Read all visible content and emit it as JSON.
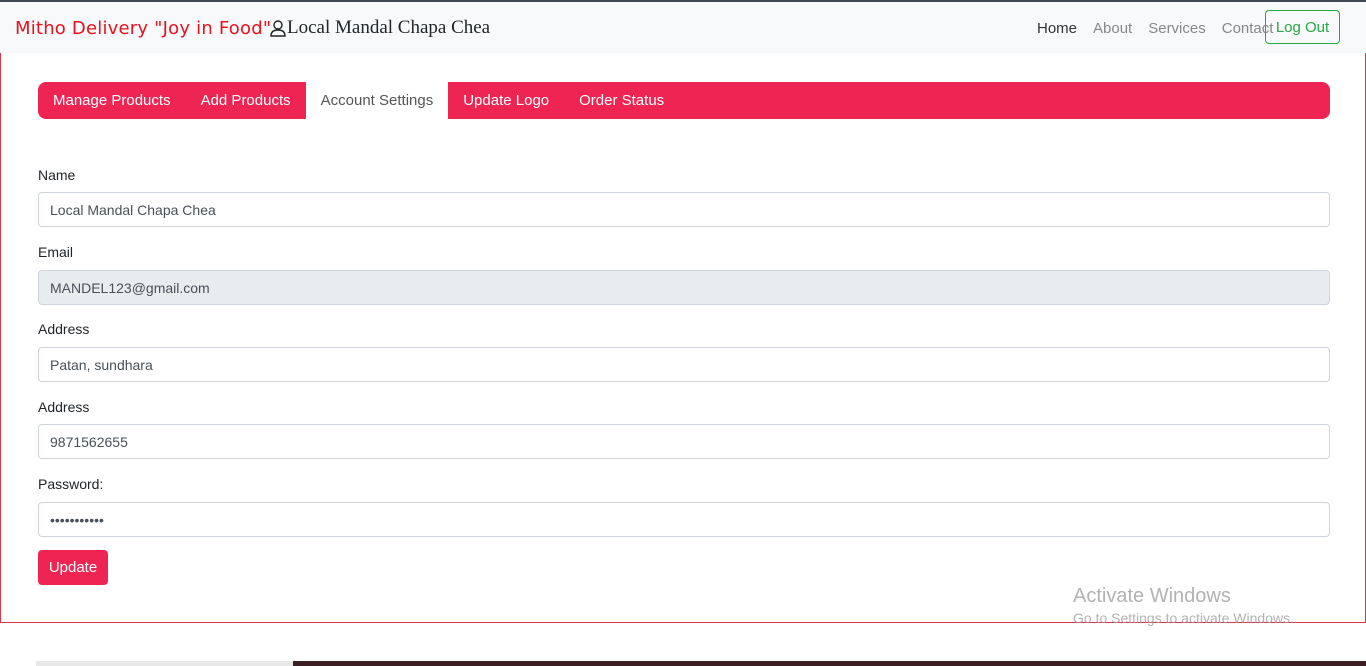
{
  "navbar": {
    "brand": "Mitho Delivery \"Joy in Food\"",
    "shop_name": "Local Mandal Chapa Chea",
    "links": [
      "Home",
      "About",
      "Services",
      "Contact"
    ],
    "logout_label": "Log Out",
    "logout_color": "#28a745"
  },
  "tabs": [
    {
      "label": "Manage Products",
      "active": false
    },
    {
      "label": "Add Products",
      "active": false
    },
    {
      "label": "Account Settings",
      "active": true
    },
    {
      "label": "Update Logo",
      "active": false
    },
    {
      "label": "Order Status",
      "active": false
    }
  ],
  "form": {
    "name_label": "Name",
    "name_value": "Local Mandal Chapa Chea",
    "email_label": "Email",
    "email_value": "MANDEL123@gmail.com",
    "address_label": "Address",
    "address_value": "Patan, sundhara",
    "phone_label": "Address",
    "phone_value": "9871562655",
    "password_label": "Password:",
    "password_value": "•••••••••••",
    "update_label": "Update"
  },
  "colors": {
    "accent": "#ee2452",
    "brand": "#e8111d"
  },
  "watermark": {
    "line1": "Activate Windows",
    "line2": "Go to Settings to activate Windows."
  }
}
